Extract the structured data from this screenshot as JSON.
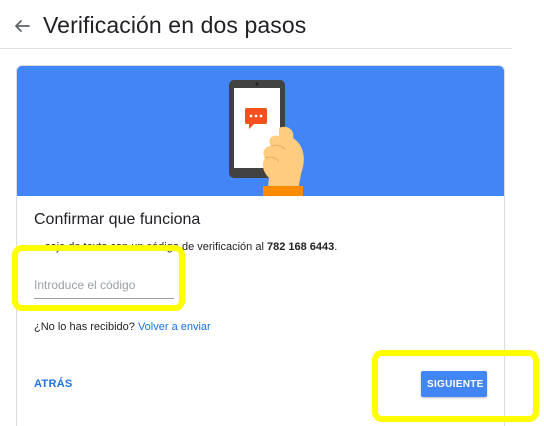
{
  "header": {
    "back_icon": "arrow-back-icon",
    "title": "Verificación en dos pasos"
  },
  "banner": {
    "color": "#4285f4",
    "illustration": "hand-holding-phone-with-message-icon"
  },
  "card": {
    "heading": "Confirmar que funciona",
    "instruction_text": "…saje de texto con un código de verificación al",
    "phone_number": "782 168 6443",
    "instruction_suffix": ".",
    "code_input": {
      "value": "",
      "placeholder": "Introduce el código"
    },
    "resend_prompt": "¿No lo has recibido?",
    "resend_link": "Volver a enviar",
    "back_label": "ATRÁS",
    "next_label": "SIGUIENTE"
  },
  "colors": {
    "accent": "#4285f4",
    "link": "#1a73e8",
    "highlight": "#ffff00"
  }
}
